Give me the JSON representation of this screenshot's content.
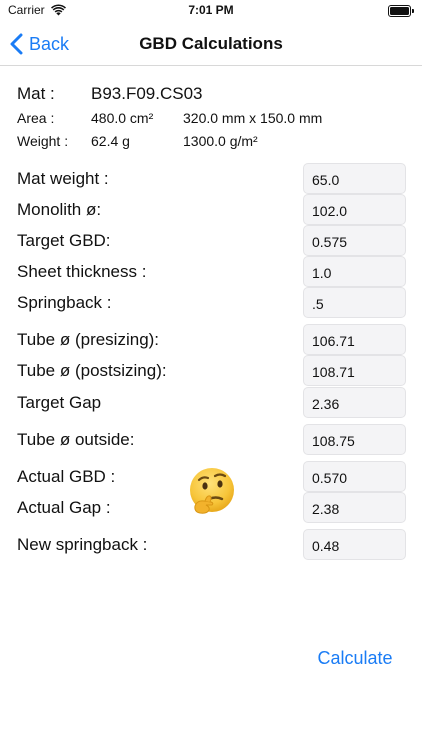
{
  "status_bar": {
    "carrier": "Carrier",
    "time": "7:01 PM",
    "wifi_icon": "wifi-icon",
    "battery_icon": "battery-icon",
    "battery_level": 1.0
  },
  "nav": {
    "back_label": "Back",
    "title": "GBD Calculations",
    "back_icon": "chevron-left-icon"
  },
  "info": {
    "mat_label": "Mat :",
    "mat_value": "B93.F09.CS03",
    "area_label": "Area :",
    "area_value": "480.0  cm²",
    "area_dims": "320.0 mm x 150.0 mm",
    "weight_label": "Weight :",
    "weight_value": "62.4  g",
    "weight_density": "1300.0 g/m²"
  },
  "form": {
    "mat_weight": {
      "label": "Mat weight :",
      "value": "65.0"
    },
    "monolith": {
      "label": "Monolith ø:",
      "value": "102.0"
    },
    "target_gbd": {
      "label": "Target GBD:",
      "value": "0.575"
    },
    "sheet_thickness": {
      "label": "Sheet thickness :",
      "value": "1.0"
    },
    "springback": {
      "label": "Springback :",
      "value": ".5"
    },
    "tube_presizing": {
      "label": "Tube ø (presizing):",
      "value": "106.71"
    },
    "tube_postsizing": {
      "label": "Tube ø (postsizing):",
      "value": "108.71"
    },
    "target_gap": {
      "label": "Target Gap",
      "value": "2.36"
    },
    "tube_outside": {
      "label": "Tube ø outside:",
      "value": "108.75"
    },
    "actual_gbd": {
      "label": "Actual GBD :",
      "value": "0.570"
    },
    "actual_gap": {
      "label": "Actual Gap :",
      "value": "2.38"
    },
    "new_springback": {
      "label": "New springback :",
      "value": "0.48"
    }
  },
  "emoji_icon": "thinking-face-icon",
  "calculate_label": "Calculate",
  "colors": {
    "accent": "#1a7cf5",
    "field_bg": "#f4f4f6",
    "emoji_yellow": "#f7c53a"
  }
}
